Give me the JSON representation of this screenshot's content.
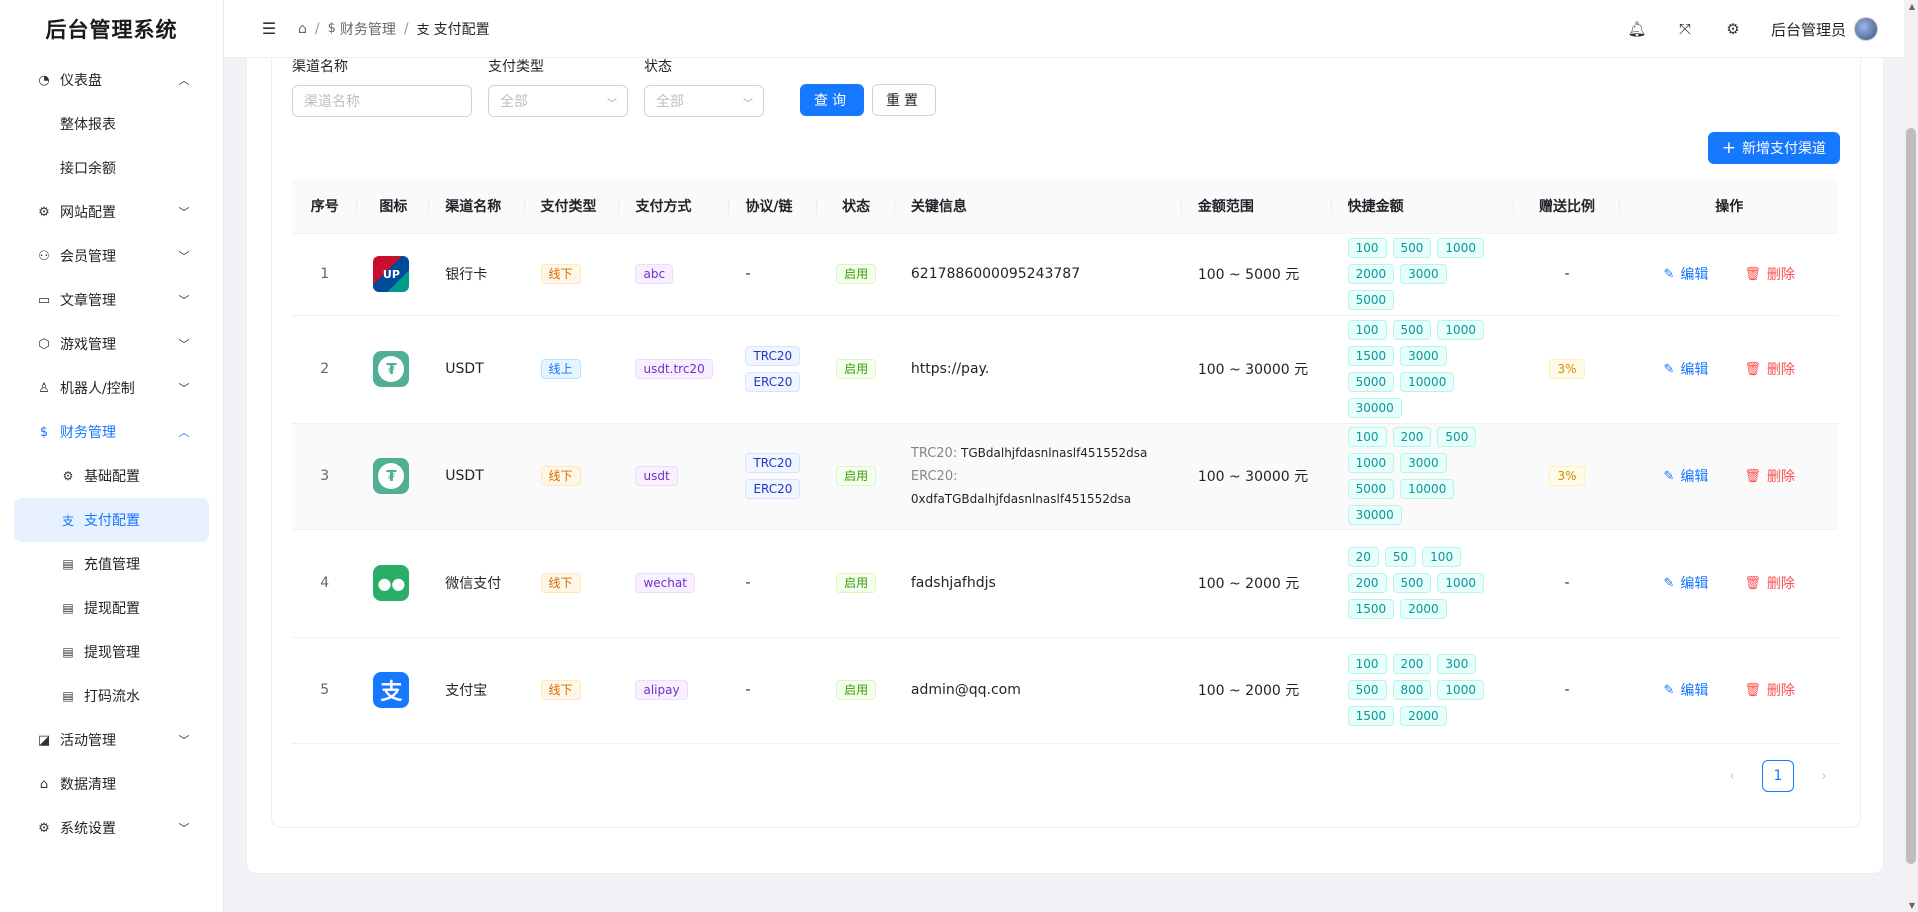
{
  "app": {
    "title": "后台管理系统"
  },
  "sidebar": {
    "items": [
      {
        "label": "仪表盘",
        "icon": "dashboard-icon",
        "expanded": true
      },
      {
        "label": "整体报表"
      },
      {
        "label": "接口余额"
      },
      {
        "label": "网站配置",
        "icon": "gear-icon"
      },
      {
        "label": "会员管理",
        "icon": "user-icon"
      },
      {
        "label": "文章管理",
        "icon": "book-icon"
      },
      {
        "label": "游戏管理",
        "icon": "cube-icon"
      },
      {
        "label": "机器人/控制",
        "icon": "robot-icon"
      },
      {
        "label": "财务管理",
        "icon": "dollar-icon",
        "expanded": true
      },
      {
        "label": "基础配置",
        "icon": "gear-icon"
      },
      {
        "label": "支付配置",
        "icon": "alipay-icon"
      },
      {
        "label": "充值管理",
        "icon": "doc-icon"
      },
      {
        "label": "提现配置",
        "icon": "doc-icon"
      },
      {
        "label": "提现管理",
        "icon": "doc-icon"
      },
      {
        "label": "打码流水",
        "icon": "doc-icon"
      },
      {
        "label": "活动管理",
        "icon": "chart-icon"
      },
      {
        "label": "数据清理",
        "icon": "bank-icon"
      },
      {
        "label": "系统设置",
        "icon": "gear-icon"
      }
    ]
  },
  "header": {
    "breadcrumb": [
      "财务管理",
      "支付配置"
    ],
    "user": "后台管理员"
  },
  "filters": {
    "name_label": "渠道名称",
    "name_placeholder": "渠道名称",
    "type_label": "支付类型",
    "type_value": "全部",
    "status_label": "状态",
    "status_value": "全部",
    "query": "查询",
    "reset": "重置"
  },
  "add_button": "新增支付渠道",
  "table": {
    "columns": [
      "序号",
      "图标",
      "渠道名称",
      "支付类型",
      "支付方式",
      "协议/链",
      "状态",
      "关键信息",
      "金额范围",
      "快捷金额",
      "赠送比例",
      "操作"
    ],
    "rows": [
      {
        "no": "1",
        "icon": "unionpay-icon",
        "name": "银行卡",
        "type": "线下",
        "method": "abc",
        "chain": [
          "-"
        ],
        "status": "启用",
        "key": "6217886000095243787",
        "range": "100 ~ 5000 元",
        "quick": [
          "100",
          "500",
          "1000",
          "2000",
          "3000",
          "5000"
        ],
        "bonus": "-"
      },
      {
        "no": "2",
        "icon": "usdt-icon",
        "name": "USDT",
        "type": "线上",
        "method": "usdt.trc20",
        "chain": [
          "TRC20",
          "ERC20"
        ],
        "status": "启用",
        "key": "https://pay.",
        "range": "100 ~ 30000 元",
        "quick": [
          "100",
          "500",
          "1000",
          "1500",
          "3000",
          "5000",
          "10000",
          "30000"
        ],
        "bonus": "3%"
      },
      {
        "no": "3",
        "icon": "usdt-icon",
        "name": "USDT",
        "type": "线下",
        "method": "usdt",
        "chain": [
          "TRC20",
          "ERC20"
        ],
        "status": "启用",
        "key_lines": [
          {
            "k": "TRC20:",
            "v": "TGBdalhjfdasnlnaslf451552dsa"
          },
          {
            "k": "ERC20:",
            "v": "0xdfaTGBdalhjfdasnlnaslf451552dsa"
          }
        ],
        "range": "100 ~ 30000 元",
        "quick": [
          "100",
          "200",
          "500",
          "1000",
          "3000",
          "5000",
          "10000",
          "30000"
        ],
        "bonus": "3%"
      },
      {
        "no": "4",
        "icon": "wechat-icon",
        "name": "微信支付",
        "type": "线下",
        "method": "wechat",
        "chain": [
          "-"
        ],
        "status": "启用",
        "key": "fadshjafhdjs",
        "range": "100 ~ 2000 元",
        "quick": [
          "20",
          "50",
          "100",
          "200",
          "500",
          "1000",
          "1500",
          "2000"
        ],
        "bonus": "-"
      },
      {
        "no": "5",
        "icon": "alipay-icon",
        "name": "支付宝",
        "type": "线下",
        "method": "alipay",
        "chain": [
          "-"
        ],
        "status": "启用",
        "key": "admin@qq.com",
        "range": "100 ~ 2000 元",
        "quick": [
          "100",
          "200",
          "300",
          "500",
          "800",
          "1000",
          "1500",
          "2000"
        ],
        "bonus": "-"
      }
    ],
    "edit": "编辑",
    "delete": "删除"
  },
  "pagination": {
    "current": "1"
  }
}
